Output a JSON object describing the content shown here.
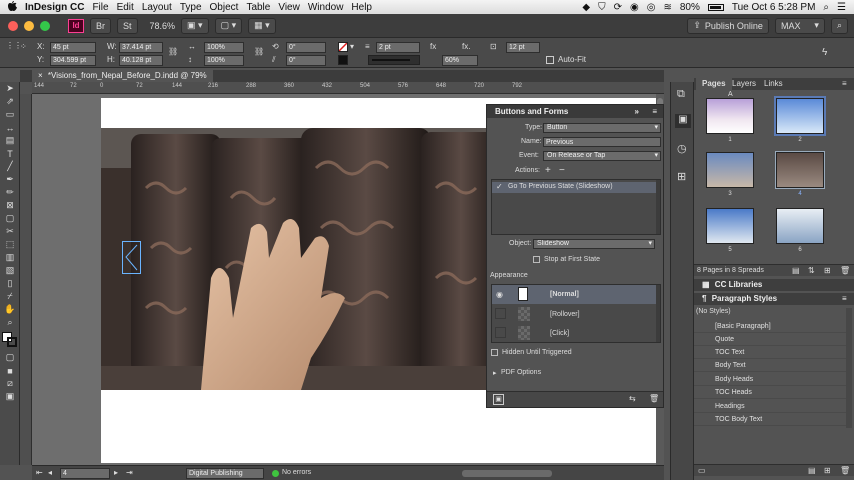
{
  "menubar": {
    "apple": "",
    "app_name": "InDesign CC",
    "items": [
      "File",
      "Edit",
      "Layout",
      "Type",
      "Object",
      "Table",
      "View",
      "Window",
      "Help"
    ],
    "battery": "80%",
    "datetime": "Tue Oct 6  5:28 PM"
  },
  "appbar": {
    "app_icon": "Id",
    "zoom": "78.6%",
    "publish_label": "Publish Online",
    "workspace": "MAX"
  },
  "control": {
    "x_label": "X:",
    "x_value": "45 pt",
    "y_label": "Y:",
    "y_value": "304.599 pt",
    "w_label": "W:",
    "w_value": "37.414 pt",
    "h_label": "H:",
    "h_value": "40.128 pt",
    "scale_x": "100%",
    "scale_y": "100%",
    "rotate": "0°",
    "shear": "0°",
    "stroke": "2 pt",
    "stroke_pct": "100%",
    "opacity": "60%",
    "size": "12 pt",
    "autofit": "Auto-Fit"
  },
  "document": {
    "tab_title": "*Visions_from_Nepal_Before_D.indd @ 79%",
    "ruler_ticks": [
      "144",
      "72",
      "0",
      "72",
      "144",
      "216",
      "288",
      "360",
      "432",
      "504",
      "576",
      "648",
      "720",
      "792"
    ]
  },
  "status": {
    "page": "4",
    "profile": "Digital Publishing",
    "preflight": "No errors"
  },
  "buttons_forms": {
    "title": "Buttons and Forms",
    "type_label": "Type:",
    "type_value": "Button",
    "name_label": "Name:",
    "name_value": "Previous",
    "event_label": "Event:",
    "event_value": "On Release or Tap",
    "actions_label": "Actions:",
    "action_item": "Go To Previous State (Slideshow)",
    "object_label": "Object:",
    "object_value": "Slideshow",
    "stop_label": "Stop at First State",
    "appearance_label": "Appearance",
    "states": [
      "[Normal]",
      "[Rollover]",
      "[Click]"
    ],
    "hidden_label": "Hidden Until Triggered",
    "pdf_label": "PDF Options"
  },
  "pages_panel": {
    "tabs": [
      "Pages",
      "Layers",
      "Links"
    ],
    "master_label": "A",
    "page_numbers": [
      "1",
      "2",
      "3",
      "4",
      "5",
      "6"
    ],
    "footer": "8 Pages in 8 Spreads"
  },
  "cc_libraries": {
    "title": "CC Libraries"
  },
  "paragraph_styles": {
    "title": "Paragraph Styles",
    "current": "(No Styles)",
    "items": [
      "[Basic Paragraph]",
      "Quote",
      "TOC Text",
      "Body Text",
      "Body Heads",
      "TOC Heads",
      "Headings",
      "TOC Body Text"
    ]
  },
  "colors": {
    "accent": "#5a7ab5",
    "panel_bg": "#535353",
    "menubar_bg": "#e8e8e8"
  }
}
